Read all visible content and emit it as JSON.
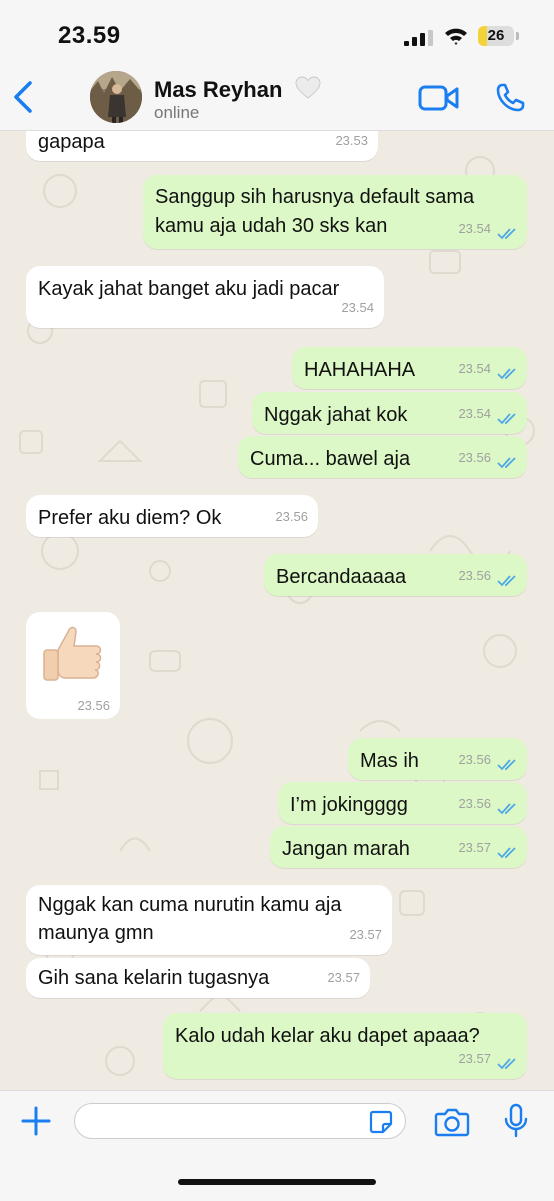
{
  "status_bar": {
    "time": "23.59",
    "battery_text": "26",
    "battery_level_percent": 26
  },
  "header": {
    "contact_name": "Mas Reyhan",
    "contact_status": "online",
    "name_suffix_icon": "white-heart-icon",
    "accent_color": "#1a7ef0"
  },
  "colors": {
    "incoming_bubble": "#ffffff",
    "outgoing_bubble": "#dcf8c6",
    "chat_background": "#efeae2",
    "read_tick": "#4fa7e8"
  },
  "messages": [
    {
      "id": "m1",
      "from": "them",
      "text": "gapapa",
      "time": "23.53"
    },
    {
      "id": "m2",
      "from": "me",
      "lines": [
        "Sanggup sih harusnya default sama",
        "kamu aja udah 30 sks kan"
      ],
      "time": "23.54",
      "read": true
    },
    {
      "id": "m3",
      "from": "them",
      "text": "Kayak jahat banget aku jadi pacar",
      "time": "23.54"
    },
    {
      "id": "m4",
      "from": "me",
      "text": "HAHAHAHA",
      "time": "23.54",
      "read": true
    },
    {
      "id": "m5",
      "from": "me",
      "text": "Nggak jahat kok",
      "time": "23.54",
      "read": true
    },
    {
      "id": "m6",
      "from": "me",
      "text": "Cuma... bawel aja",
      "time": "23.56",
      "read": true
    },
    {
      "id": "m7",
      "from": "them",
      "text": "Prefer aku diem? Ok",
      "time": "23.56"
    },
    {
      "id": "m8",
      "from": "me",
      "text": "Bercandaaaaa",
      "time": "23.56",
      "read": true
    },
    {
      "id": "m9",
      "from": "them",
      "sticker": "thumbs-up",
      "time": "23.56"
    },
    {
      "id": "m10",
      "from": "me",
      "text": "Mas ih",
      "time": "23.56",
      "read": true
    },
    {
      "id": "m11",
      "from": "me",
      "text": "I’m jokingggg",
      "time": "23.56",
      "read": true
    },
    {
      "id": "m12",
      "from": "me",
      "text": "Jangan marah",
      "time": "23.57",
      "read": true
    },
    {
      "id": "m13",
      "from": "them",
      "lines": [
        "Nggak kan cuma nurutin kamu aja",
        "maunya gmn"
      ],
      "time": "23.57"
    },
    {
      "id": "m14",
      "from": "them",
      "text": "Gih sana kelarin tugasnya",
      "time": "23.57"
    },
    {
      "id": "m15",
      "from": "me",
      "text": "Kalo udah kelar aku dapet apaaa?",
      "time": "23.57",
      "read": true
    }
  ],
  "input": {
    "value": "",
    "placeholder": ""
  },
  "icons": {
    "back": "chevron-left-icon",
    "video": "video-camera-icon",
    "call": "phone-icon",
    "attach": "plus-icon",
    "sticker": "sticker-icon",
    "camera": "camera-icon",
    "mic": "microphone-icon"
  }
}
